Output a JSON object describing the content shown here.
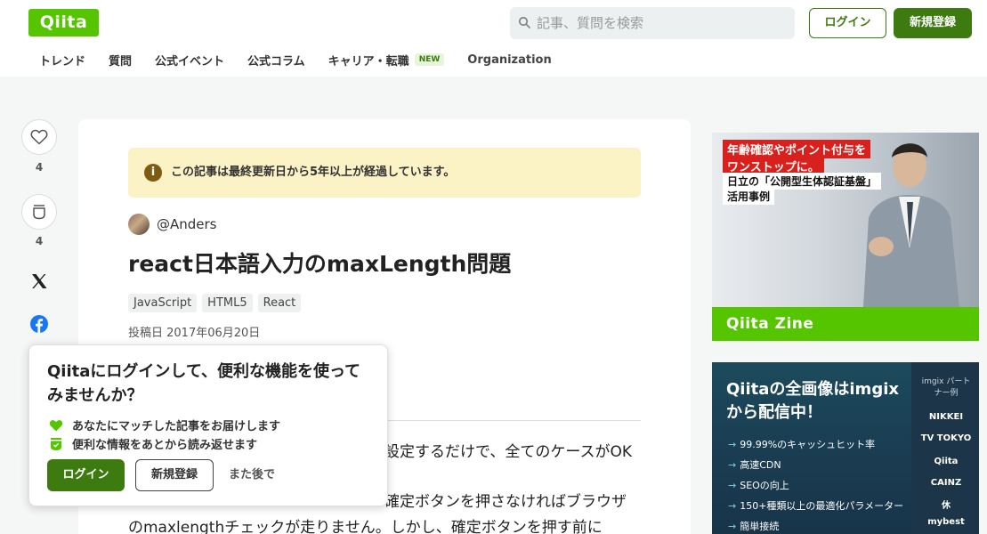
{
  "header": {
    "logo": "Qiita",
    "search_placeholder": "記事、質問を検索",
    "login_label": "ログイン",
    "signup_label": "新規登録"
  },
  "nav": {
    "items": [
      "トレンド",
      "質問",
      "公式イベント",
      "公式コラム",
      "キャリア・転職",
      "Organization"
    ],
    "new_badge": "NEW"
  },
  "rail": {
    "like_count": "4",
    "stock_count": "4"
  },
  "article": {
    "notice": "この記事は最終更新日から5年以上が経過しています。",
    "author": "@Anders",
    "title": "react日本語入力のmaxLength問題",
    "tags": [
      "JavaScript",
      "HTML5",
      "React"
    ],
    "posted": "投稿日 2017年06月20日",
    "body": {
      "line1_tail": "設定するだけで、全てのケースがOK",
      "line2_tail": "確定ボタンを押さなければブラウザ",
      "line3": "のmaxlengthチェックが走りません。しかし、確定ボタンを押す前に"
    }
  },
  "popup": {
    "title": "Qiitaにログインして、便利な機能を使ってみませんか？",
    "benefits": [
      "あなたにマッチした記事をお届けします",
      "便利な情報をあとから読み返せます"
    ],
    "login_label": "ログイン",
    "signup_label": "新規登録",
    "later_label": "また後で"
  },
  "ad1": {
    "line1": "年齢確認やポイント付与を",
    "line2": "ワンストップに。",
    "line3": "日立の「公開型生体認証基盤」",
    "line4": "活用事例",
    "brand": "Qiita Zine"
  },
  "ad2": {
    "title1": "Qiitaの全画像はimgix",
    "title2": "から配信中！",
    "items": [
      "99.99%のキャッシュヒット率",
      "高速CDN",
      "SEOの向上",
      "150+種類以上の最適化パラメーター",
      "簡単接続"
    ],
    "partner_label": "imgix パートナー例",
    "partners": [
      "NIKKEI",
      "TV TOKYO",
      "Qiita",
      "CAINZ",
      "休",
      "mybest"
    ]
  },
  "colors": {
    "brand": "#55c500",
    "primary_button": "#3d7a10",
    "notice_bg": "#fbf2c6"
  }
}
